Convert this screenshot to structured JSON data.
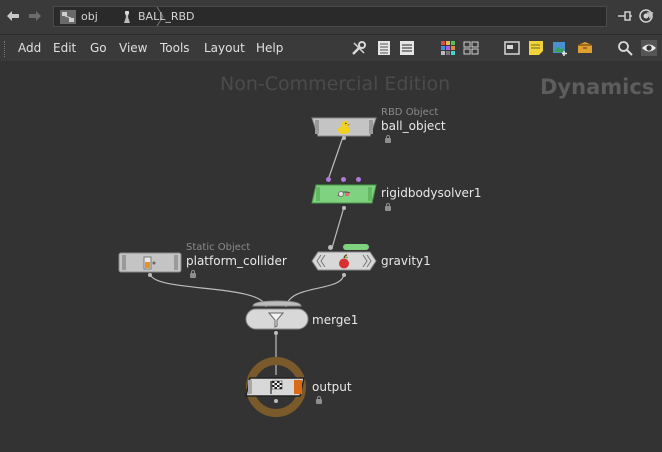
{
  "pathbar": {
    "back_icon": "arrow-left-icon",
    "forward_icon": "arrow-right-icon",
    "crumbs": [
      {
        "label": "obj",
        "icon": "obj-network-icon"
      },
      {
        "label": "BALL_RBD",
        "icon": "geo-node-icon"
      }
    ],
    "dropdown_glyph": "▼"
  },
  "menubar": {
    "items": [
      "Add",
      "Edit",
      "Go",
      "View",
      "Tools",
      "Layout",
      "Help"
    ]
  },
  "network": {
    "watermark": "Non-Commercial Edition",
    "context_label": "Dynamics",
    "nodes": [
      {
        "name": "ball_object",
        "type_label": "RBD Object",
        "icon": "rubber-duck-icon"
      },
      {
        "name": "rigidbodysolver1",
        "icon": "rigid-body-solver-icon"
      },
      {
        "name": "platform_collider",
        "type_label": "Static Object",
        "icon": "static-object-icon"
      },
      {
        "name": "gravity1",
        "icon": "gravity-apple-icon"
      },
      {
        "name": "merge1",
        "icon": "funnel-icon"
      },
      {
        "name": "output",
        "icon": "checkered-flag-icon",
        "display_flag_color": "#d96b17"
      }
    ]
  },
  "colors": {
    "background": "#333333",
    "solver_node": "#7fd27f",
    "output_ring": "#7a5a2a",
    "wire": "#bdbdbd"
  }
}
